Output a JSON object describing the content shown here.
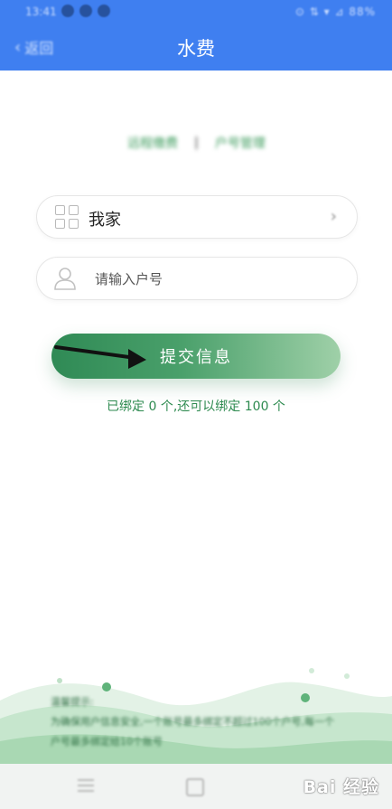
{
  "status_bar": {
    "time": "13:41",
    "indicators": "⊙ ⇅ ▾ ⊿ 88%"
  },
  "header": {
    "back_label": "返回",
    "title": "水费"
  },
  "tabs": {
    "left": "远程缴费",
    "separator": "|",
    "right": "户号管理"
  },
  "form": {
    "home_label": "我家",
    "account_placeholder": "请输入户号",
    "account_value": ""
  },
  "submit": {
    "label": "提交信息"
  },
  "bind_status": "已绑定 0 个,还可以绑定 100 个",
  "notice": {
    "title": "温馨提示:",
    "line1": "为确保用户信息安全,一个账号最多绑定不超过100个户号,每一个",
    "line2": "户号最多绑定给10个账号"
  },
  "watermark": "Bai 经验",
  "colors": {
    "header_blue": "#3f7ff0",
    "brand_green": "#2f8a55",
    "status_green": "#2d8a4f"
  },
  "icons": {
    "back": "chevron-left-icon",
    "home": "grid-icon",
    "home_action": "chevron-right-icon",
    "account": "person-icon",
    "annotation": "arrow-icon"
  }
}
